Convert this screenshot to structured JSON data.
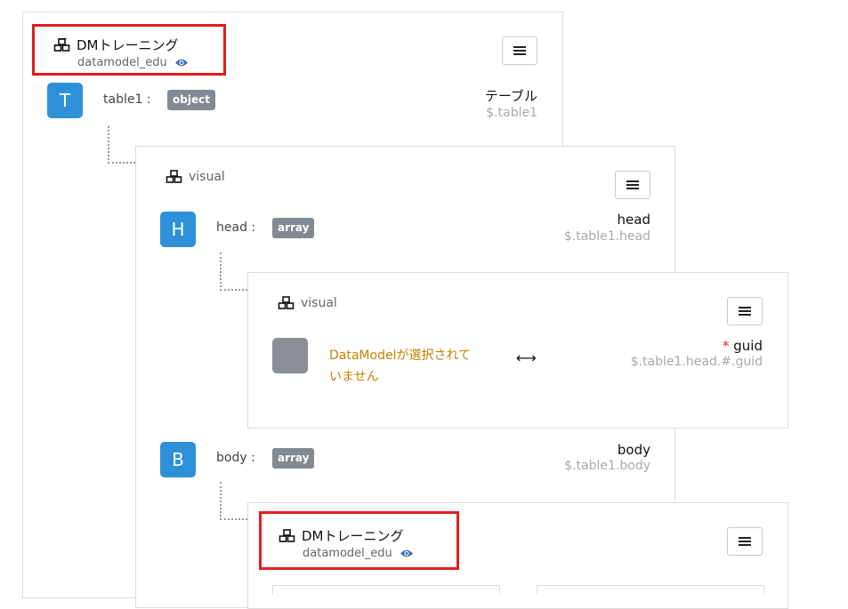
{
  "root": {
    "title": "DMトレーニング",
    "subtitle": "datamodel_edu",
    "icon": "cubes-icon",
    "field": {
      "avatar": "T",
      "name": "table1 :",
      "type": "object",
      "label": "テーブル",
      "path": "$.table1"
    }
  },
  "head_section": {
    "visual_label": "visual",
    "icon": "cubes-icon",
    "field": {
      "avatar": "H",
      "name": "head :",
      "type": "array",
      "label": "head",
      "path": "$.table1.head"
    }
  },
  "guid_section": {
    "visual_label": "visual",
    "icon": "cubes-icon",
    "warning_line1": "DataModelが選択されて",
    "warning_line2": "いません",
    "arrow": "⟷",
    "required_mark": "*",
    "label": "guid",
    "path": "$.table1.head.#.guid"
  },
  "body_section": {
    "field": {
      "avatar": "B",
      "name": "body :",
      "type": "array",
      "label": "body",
      "path": "$.table1.body"
    }
  },
  "body_card": {
    "title": "DMトレーニング",
    "subtitle": "datamodel_edu",
    "icon": "cubes-icon"
  },
  "colors": {
    "accent": "#2e90d9",
    "badge": "#838a91",
    "warning": "#c97f00",
    "highlight": "#e01e1e"
  }
}
